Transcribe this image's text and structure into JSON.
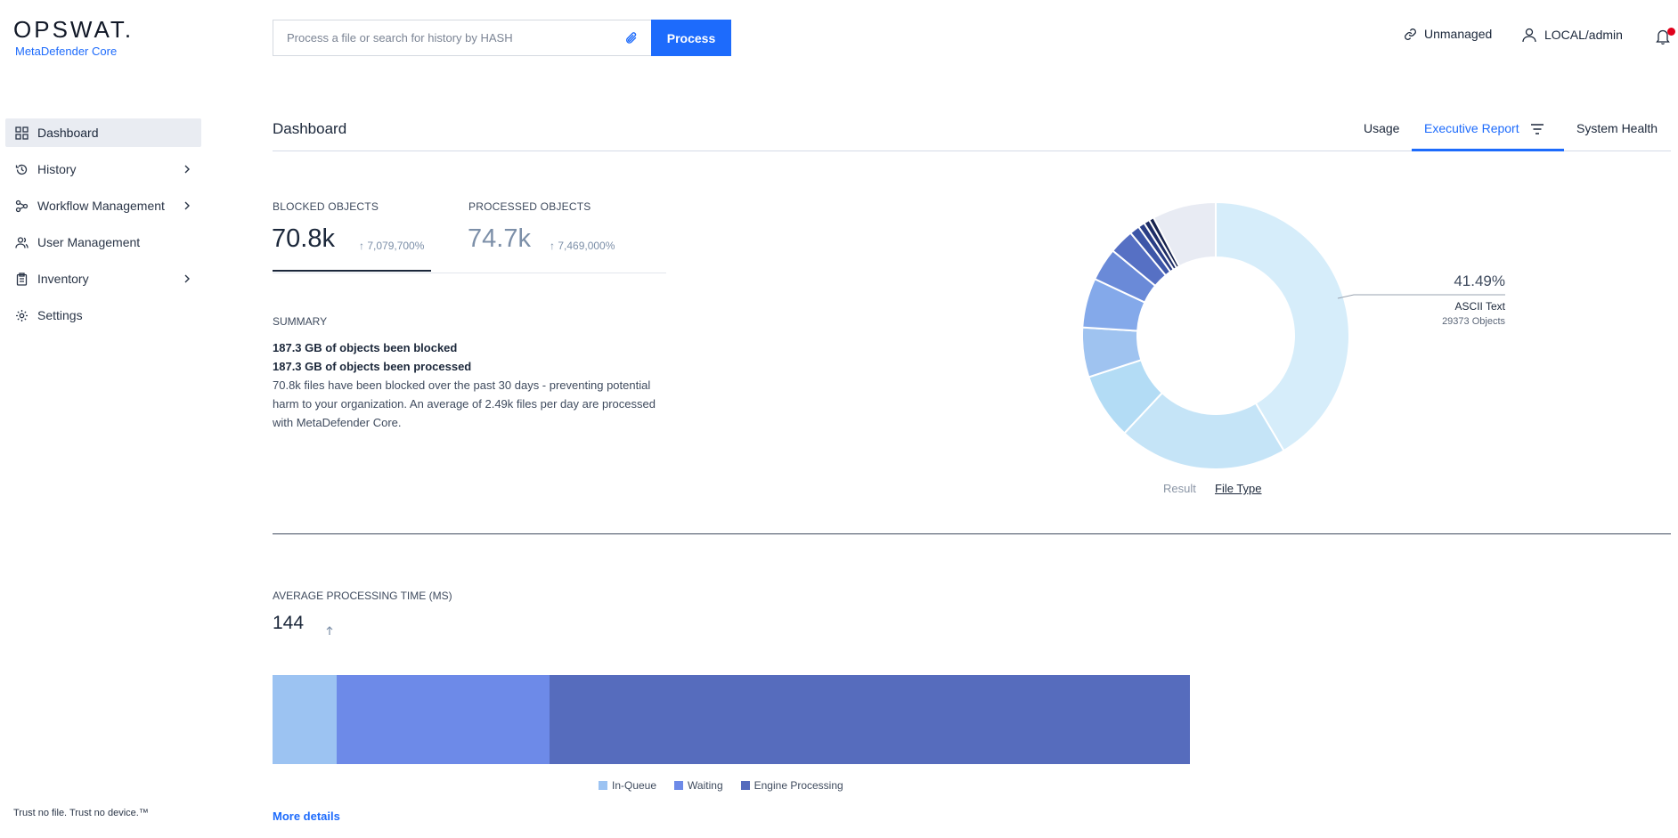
{
  "brand": {
    "logo": "OPSWAT.",
    "product": "MetaDefender Core",
    "tagline": "Trust no file. Trust no device.™"
  },
  "sidebar": {
    "items": [
      {
        "label": "Dashboard",
        "icon": "grid-icon"
      },
      {
        "label": "History",
        "icon": "history-icon"
      },
      {
        "label": "Workflow Management",
        "icon": "workflow-icon"
      },
      {
        "label": "User Management",
        "icon": "users-icon"
      },
      {
        "label": "Inventory",
        "icon": "clipboard-icon"
      },
      {
        "label": "Settings",
        "icon": "gear-icon"
      }
    ]
  },
  "search": {
    "placeholder": "Process a file or search for history by HASH",
    "button": "Process"
  },
  "header": {
    "unmanaged": "Unmanaged",
    "user": "LOCAL/admin"
  },
  "dashboard": {
    "title": "Dashboard",
    "tabs": [
      {
        "label": "Usage"
      },
      {
        "label": "Executive Report"
      },
      {
        "label": "System Health"
      }
    ]
  },
  "stats": {
    "blocked": {
      "label": "BLOCKED OBJECTS",
      "value": "70.8k",
      "delta": "7,079,700%"
    },
    "processed": {
      "label": "PROCESSED OBJECTS",
      "value": "74.7k",
      "delta": "7,469,000%"
    }
  },
  "summary": {
    "label": "SUMMARY",
    "line1": "187.3 GB of objects been blocked",
    "line2": "187.3 GB of objects been processed",
    "text": "70.8k files have been blocked over the past 30 days - preventing potential harm to your organization. An average of 2.49k files per day are processed with MetaDefender Core."
  },
  "chart_data": [
    {
      "type": "pie",
      "variant": "donut",
      "title": "",
      "highlight": {
        "percent": "41.49%",
        "label": "ASCII Text",
        "count": "29373 Objects"
      },
      "slices": [
        {
          "value": 41.49,
          "color": "#d6edfa"
        },
        {
          "value": 20.5,
          "color": "#c5e4f7"
        },
        {
          "value": 8.0,
          "color": "#b3dcf5"
        },
        {
          "value": 6.0,
          "color": "#9fc3f0"
        },
        {
          "value": 6.0,
          "color": "#84a9ea"
        },
        {
          "value": 4.0,
          "color": "#6a8ad8"
        },
        {
          "value": 3.0,
          "color": "#5670c4"
        },
        {
          "value": 1.2,
          "color": "#3d56a8"
        },
        {
          "value": 0.8,
          "color": "#2a3e86"
        },
        {
          "value": 0.7,
          "color": "#1e2d66"
        },
        {
          "value": 0.6,
          "color": "#16224d"
        },
        {
          "value": 7.71,
          "color": "#e8ebf3"
        }
      ],
      "toggles": [
        {
          "label": "Result"
        },
        {
          "label": "File Type"
        }
      ]
    },
    {
      "type": "bar",
      "variant": "stacked-horizontal",
      "title": "AVERAGE PROCESSING TIME (MS)",
      "total": "144",
      "series": [
        {
          "name": "In-Queue",
          "value": 7,
          "color": "#9cc3f2"
        },
        {
          "name": "Waiting",
          "value": 23.2,
          "color": "#6d8ae8"
        },
        {
          "name": "Engine Processing",
          "value": 69.8,
          "color": "#566cbd"
        }
      ],
      "scale_max": 100
    }
  ],
  "more_details": "More details"
}
